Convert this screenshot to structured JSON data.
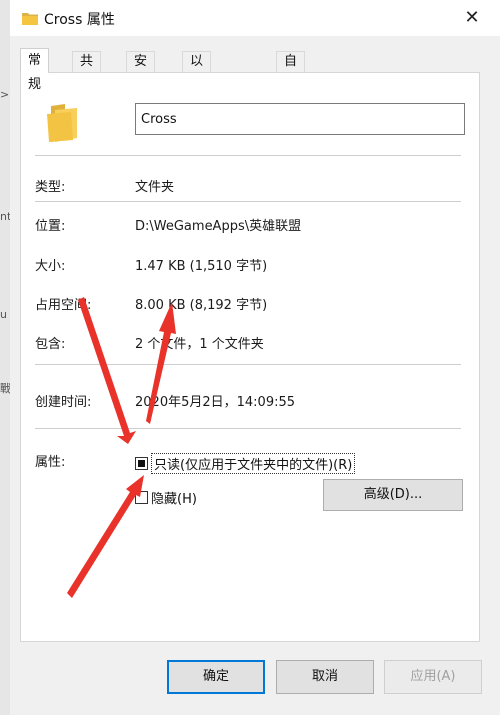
{
  "window": {
    "title": "Cross 属性",
    "close_glyph": "✕"
  },
  "tabs": [
    {
      "label": "常规",
      "active": true
    },
    {
      "label": "共享",
      "active": false
    },
    {
      "label": "安全",
      "active": false
    },
    {
      "label": "以前的版本",
      "active": false
    },
    {
      "label": "自定义",
      "active": false
    }
  ],
  "general": {
    "name_value": "Cross",
    "rows": [
      {
        "label": "类型:",
        "value": "文件夹"
      },
      {
        "label": "位置:",
        "value": "D:\\WeGameApps\\英雄联盟"
      },
      {
        "label": "大小:",
        "value": "1.47 KB (1,510 字节)"
      },
      {
        "label": "占用空间:",
        "value": "8.00 KB (8,192 字节)"
      },
      {
        "label": "包含:",
        "value": "2 个文件，1 个文件夹"
      },
      {
        "label": "创建时间:",
        "value": "2020年5月2日，14:09:55"
      }
    ],
    "attributes_label": "属性:",
    "readonly_label": "只读(仅应用于文件夹中的文件)(R)",
    "hidden_label": "隐藏(H)",
    "advanced_label": "高级(D)..."
  },
  "footer": {
    "ok": "确定",
    "cancel": "取消",
    "apply": "应用(A)"
  },
  "icons": {
    "folder": "folder-icon",
    "close": "close-icon"
  },
  "colors": {
    "annotation_arrow": "#e8322a",
    "folder": "#f5c542",
    "accent": "#0078d7"
  }
}
